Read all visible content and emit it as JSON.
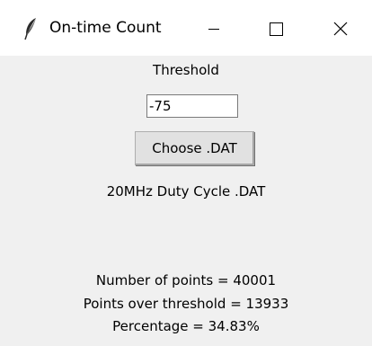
{
  "window": {
    "title": "On-time Count",
    "icon": "feather-icon",
    "controls": {
      "minimize_icon": "minimize-icon",
      "maximize_icon": "maximize-icon",
      "close_icon": "close-icon"
    }
  },
  "form": {
    "threshold_label": "Threshold",
    "threshold_value": "-75",
    "choose_button_label": "Choose .DAT",
    "selected_file": "20MHz Duty Cycle .DAT"
  },
  "results": {
    "points_line": "Number of points = 40001",
    "over_threshold_line": "Points over threshold = 13933",
    "percentage_line": "Percentage = 34.83%"
  },
  "colors": {
    "window_background": "#f0f0f0",
    "titlebar_background": "#ffffff",
    "button_background": "#e1e1e1"
  }
}
